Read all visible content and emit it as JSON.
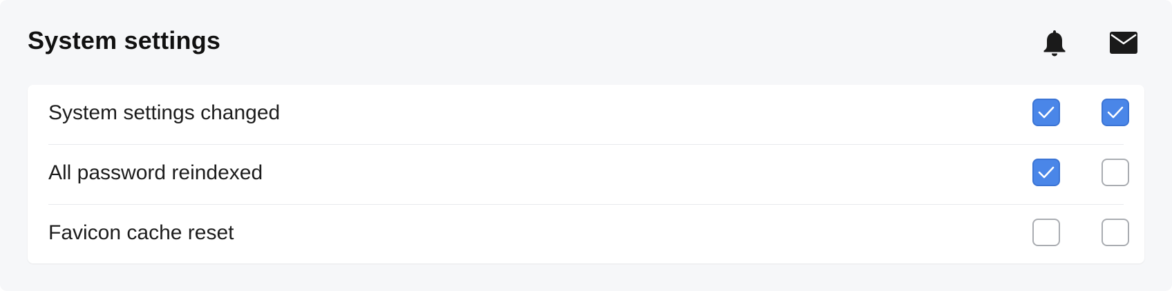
{
  "section": {
    "title": "System settings",
    "columns": [
      {
        "icon": "bell-icon",
        "channel": "push"
      },
      {
        "icon": "mail-icon",
        "channel": "email"
      }
    ]
  },
  "rows": [
    {
      "label": "System settings changed",
      "push": true,
      "email": true
    },
    {
      "label": "All password reindexed",
      "push": true,
      "email": false
    },
    {
      "label": "Favicon cache reset",
      "push": false,
      "email": false
    }
  ],
  "colors": {
    "checked": "#4a86e8",
    "unchecked_border": "#a9acb1",
    "panel_bg": "#f6f7f9",
    "card_bg": "#ffffff"
  }
}
